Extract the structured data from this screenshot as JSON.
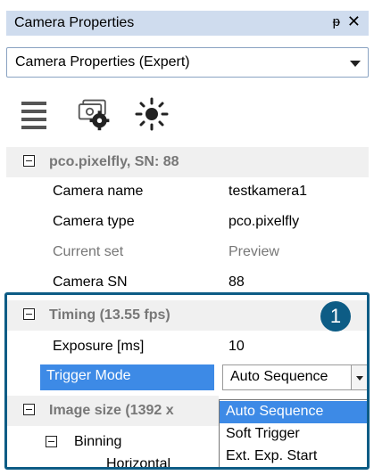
{
  "panel": {
    "title": "Camera Properties",
    "pin_glyph": "ᵽ",
    "close_glyph": "✕"
  },
  "view_selector": {
    "value": "Camera Properties (Expert)"
  },
  "toolbar": {
    "icons": [
      "hamburger-icon",
      "camera-settings-icon",
      "brightness-icon"
    ]
  },
  "groups": {
    "camera": {
      "title": "pco.pixelfly, SN: 88",
      "rows": [
        {
          "label": "Camera name",
          "value": "testkamera1"
        },
        {
          "label": "Camera type",
          "value": "pco.pixelfly"
        },
        {
          "label": "Current set",
          "value": "Preview"
        },
        {
          "label": "Camera SN",
          "value": "88"
        }
      ]
    },
    "timing": {
      "title": "Timing (13.55 fps)",
      "exposure_label": "Exposure [ms]",
      "exposure_value": "10",
      "trigger_label": "Trigger Mode",
      "trigger_value": "Auto Sequence"
    },
    "image_size": {
      "title": "Image size (1392 x",
      "binning_label": "Binning",
      "horizontal_label": "Horizontal"
    }
  },
  "dropdown": {
    "options": [
      "Auto Sequence",
      "Soft Trigger",
      "Ext. Exp. Start"
    ],
    "selected_index": 0
  },
  "callout": {
    "number": "1"
  },
  "colors": {
    "highlight_frame": "#0d5c85",
    "selection": "#3d8ae6",
    "titlebar": "#cfdcee"
  }
}
